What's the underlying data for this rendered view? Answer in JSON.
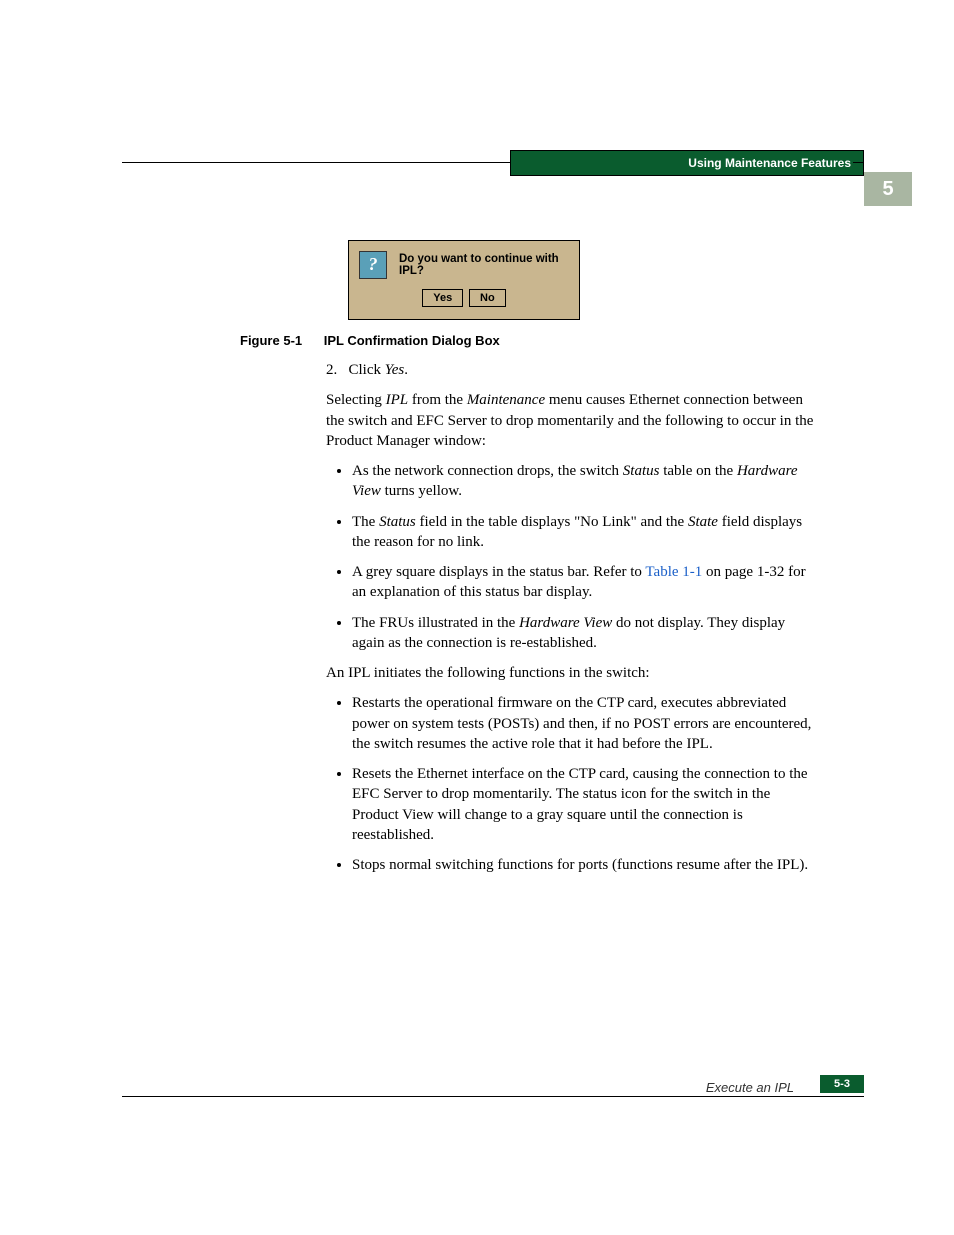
{
  "header": {
    "section_title": "Using Maintenance Features",
    "chapter_number": "5"
  },
  "dialog": {
    "icon_glyph": "?",
    "question": "Do you want to continue with IPL?",
    "yes": "Yes",
    "no": "No"
  },
  "figure_caption": {
    "label": "Figure 5-1",
    "title": "IPL Confirmation Dialog Box"
  },
  "step": {
    "number": "2.",
    "text_pre": "Click ",
    "text_italic": "Yes",
    "text_post": "."
  },
  "para1": {
    "t1": "Selecting ",
    "i1": "IPL",
    "t2": " from the ",
    "i2": "Maintenance",
    "t3": " menu causes Ethernet connection between the switch and EFC Server to drop momentarily and the following to occur in the Product Manager window:"
  },
  "bullets1": {
    "b1_t1": "As the network connection drops, the switch ",
    "b1_i1": "Status",
    "b1_t2": " table on the ",
    "b1_i2": "Hardware View",
    "b1_t3": " turns yellow.",
    "b2_t1": "The ",
    "b2_i1": "Status",
    "b2_t2": " field in the table displays \"No Link\" and the ",
    "b2_i2": "State",
    "b2_t3": " field displays the reason for no link.",
    "b3_t1": "A grey square displays in the status bar. Refer to ",
    "b3_link": "Table 1-1",
    "b3_t2": " on page 1-32 for an explanation of this status bar display.",
    "b4_t1": "The FRUs illustrated in the ",
    "b4_i1": "Hardware View",
    "b4_t2": " do not display. They display again as the connection is re-established."
  },
  "para2": "An IPL initiates the following functions in the switch:",
  "bullets2": {
    "b1": "Restarts the operational firmware on the CTP card, executes abbreviated power on system tests (POSTs) and then, if no POST errors are encountered, the switch resumes the active role that it had before the IPL.",
    "b2": "Resets the Ethernet interface on the CTP card, causing the connection to the EFC Server to drop momentarily. The status icon for the switch in the Product View will change to a gray square until the connection is reestablished.",
    "b3": "Stops normal switching functions for ports (functions resume after the IPL)."
  },
  "footer": {
    "section": "Execute an IPL",
    "page": "5-3"
  }
}
